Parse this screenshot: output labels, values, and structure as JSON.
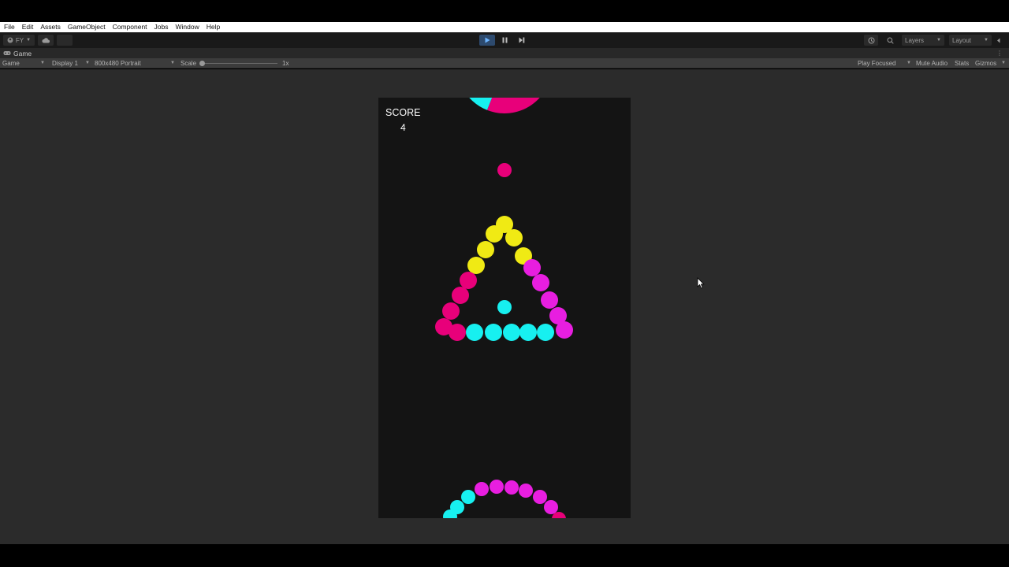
{
  "menu": [
    "File",
    "Edit",
    "Assets",
    "GameObject",
    "Component",
    "Jobs",
    "Window",
    "Help"
  ],
  "toolbar": {
    "account": "FY",
    "layers_label": "Layers",
    "layout_label": "Layout",
    "play_state": "playing"
  },
  "panel": {
    "tab_label": "Game",
    "mode_select": "Game",
    "display_select": "Display 1",
    "resolution_select": "800x480 Portrait",
    "scale_label": "Scale",
    "scale_value": "1x",
    "play_focused": "Play Focused",
    "mute_audio": "Mute Audio",
    "stats": "Stats",
    "gizmos": "Gizmos"
  },
  "game": {
    "score_label": "SCORE",
    "score_value": "4",
    "colors": {
      "magenta": "#e8007a",
      "violet": "#e81ee0",
      "yellow": "#f0ea14",
      "cyan": "#17f0f0",
      "background": "#141414"
    }
  }
}
